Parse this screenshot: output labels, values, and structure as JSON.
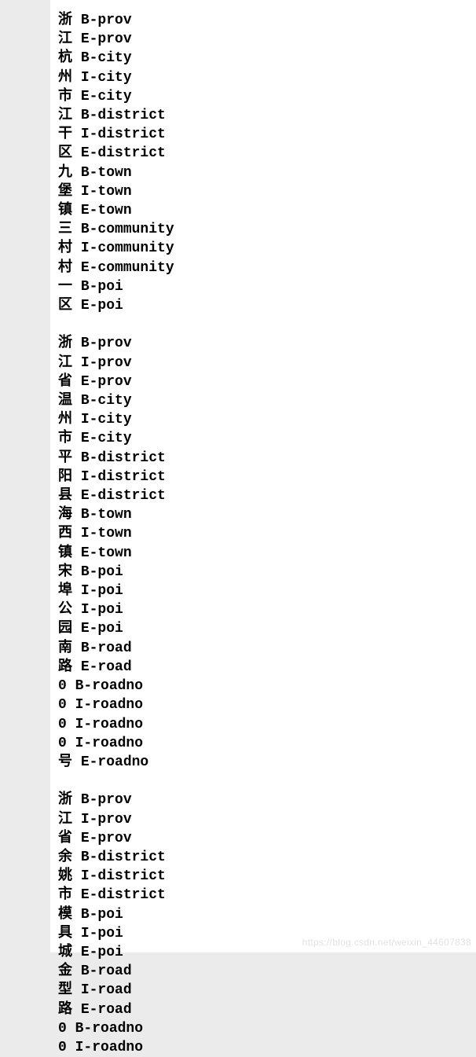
{
  "blocks": [
    [
      {
        "char": "浙",
        "tag": "B-prov"
      },
      {
        "char": "江",
        "tag": "E-prov"
      },
      {
        "char": "杭",
        "tag": "B-city"
      },
      {
        "char": "州",
        "tag": "I-city"
      },
      {
        "char": "市",
        "tag": "E-city"
      },
      {
        "char": "江",
        "tag": "B-district"
      },
      {
        "char": "干",
        "tag": "I-district"
      },
      {
        "char": "区",
        "tag": "E-district"
      },
      {
        "char": "九",
        "tag": "B-town"
      },
      {
        "char": "堡",
        "tag": "I-town"
      },
      {
        "char": "镇",
        "tag": "E-town"
      },
      {
        "char": "三",
        "tag": "B-community"
      },
      {
        "char": "村",
        "tag": "I-community"
      },
      {
        "char": "村",
        "tag": "E-community"
      },
      {
        "char": "一",
        "tag": "B-poi"
      },
      {
        "char": "区",
        "tag": "E-poi"
      }
    ],
    [
      {
        "char": "浙",
        "tag": "B-prov"
      },
      {
        "char": "江",
        "tag": "I-prov"
      },
      {
        "char": "省",
        "tag": "E-prov"
      },
      {
        "char": "温",
        "tag": "B-city"
      },
      {
        "char": "州",
        "tag": "I-city"
      },
      {
        "char": "市",
        "tag": "E-city"
      },
      {
        "char": "平",
        "tag": "B-district"
      },
      {
        "char": "阳",
        "tag": "I-district"
      },
      {
        "char": "县",
        "tag": "E-district"
      },
      {
        "char": "海",
        "tag": "B-town"
      },
      {
        "char": "西",
        "tag": "I-town"
      },
      {
        "char": "镇",
        "tag": "E-town"
      },
      {
        "char": "宋",
        "tag": "B-poi"
      },
      {
        "char": "埠",
        "tag": "I-poi"
      },
      {
        "char": "公",
        "tag": "I-poi"
      },
      {
        "char": "园",
        "tag": "E-poi"
      },
      {
        "char": "南",
        "tag": "B-road"
      },
      {
        "char": "路",
        "tag": "E-road"
      },
      {
        "char": "0",
        "tag": "B-roadno"
      },
      {
        "char": "0",
        "tag": "I-roadno"
      },
      {
        "char": "0",
        "tag": "I-roadno"
      },
      {
        "char": "0",
        "tag": "I-roadno"
      },
      {
        "char": "号",
        "tag": "E-roadno"
      }
    ],
    [
      {
        "char": "浙",
        "tag": "B-prov"
      },
      {
        "char": "江",
        "tag": "I-prov"
      },
      {
        "char": "省",
        "tag": "E-prov"
      },
      {
        "char": "余",
        "tag": "B-district"
      },
      {
        "char": "姚",
        "tag": "I-district"
      },
      {
        "char": "市",
        "tag": "E-district"
      },
      {
        "char": "模",
        "tag": "B-poi"
      },
      {
        "char": "具",
        "tag": "I-poi"
      },
      {
        "char": "城",
        "tag": "E-poi"
      },
      {
        "char": "金",
        "tag": "B-road"
      },
      {
        "char": "型",
        "tag": "I-road"
      },
      {
        "char": "路",
        "tag": "E-road"
      },
      {
        "char": "0",
        "tag": "B-roadno"
      },
      {
        "char": "0",
        "tag": "I-roadno"
      }
    ]
  ],
  "watermark": "https://blog.csdn.net/weixin_44607838"
}
